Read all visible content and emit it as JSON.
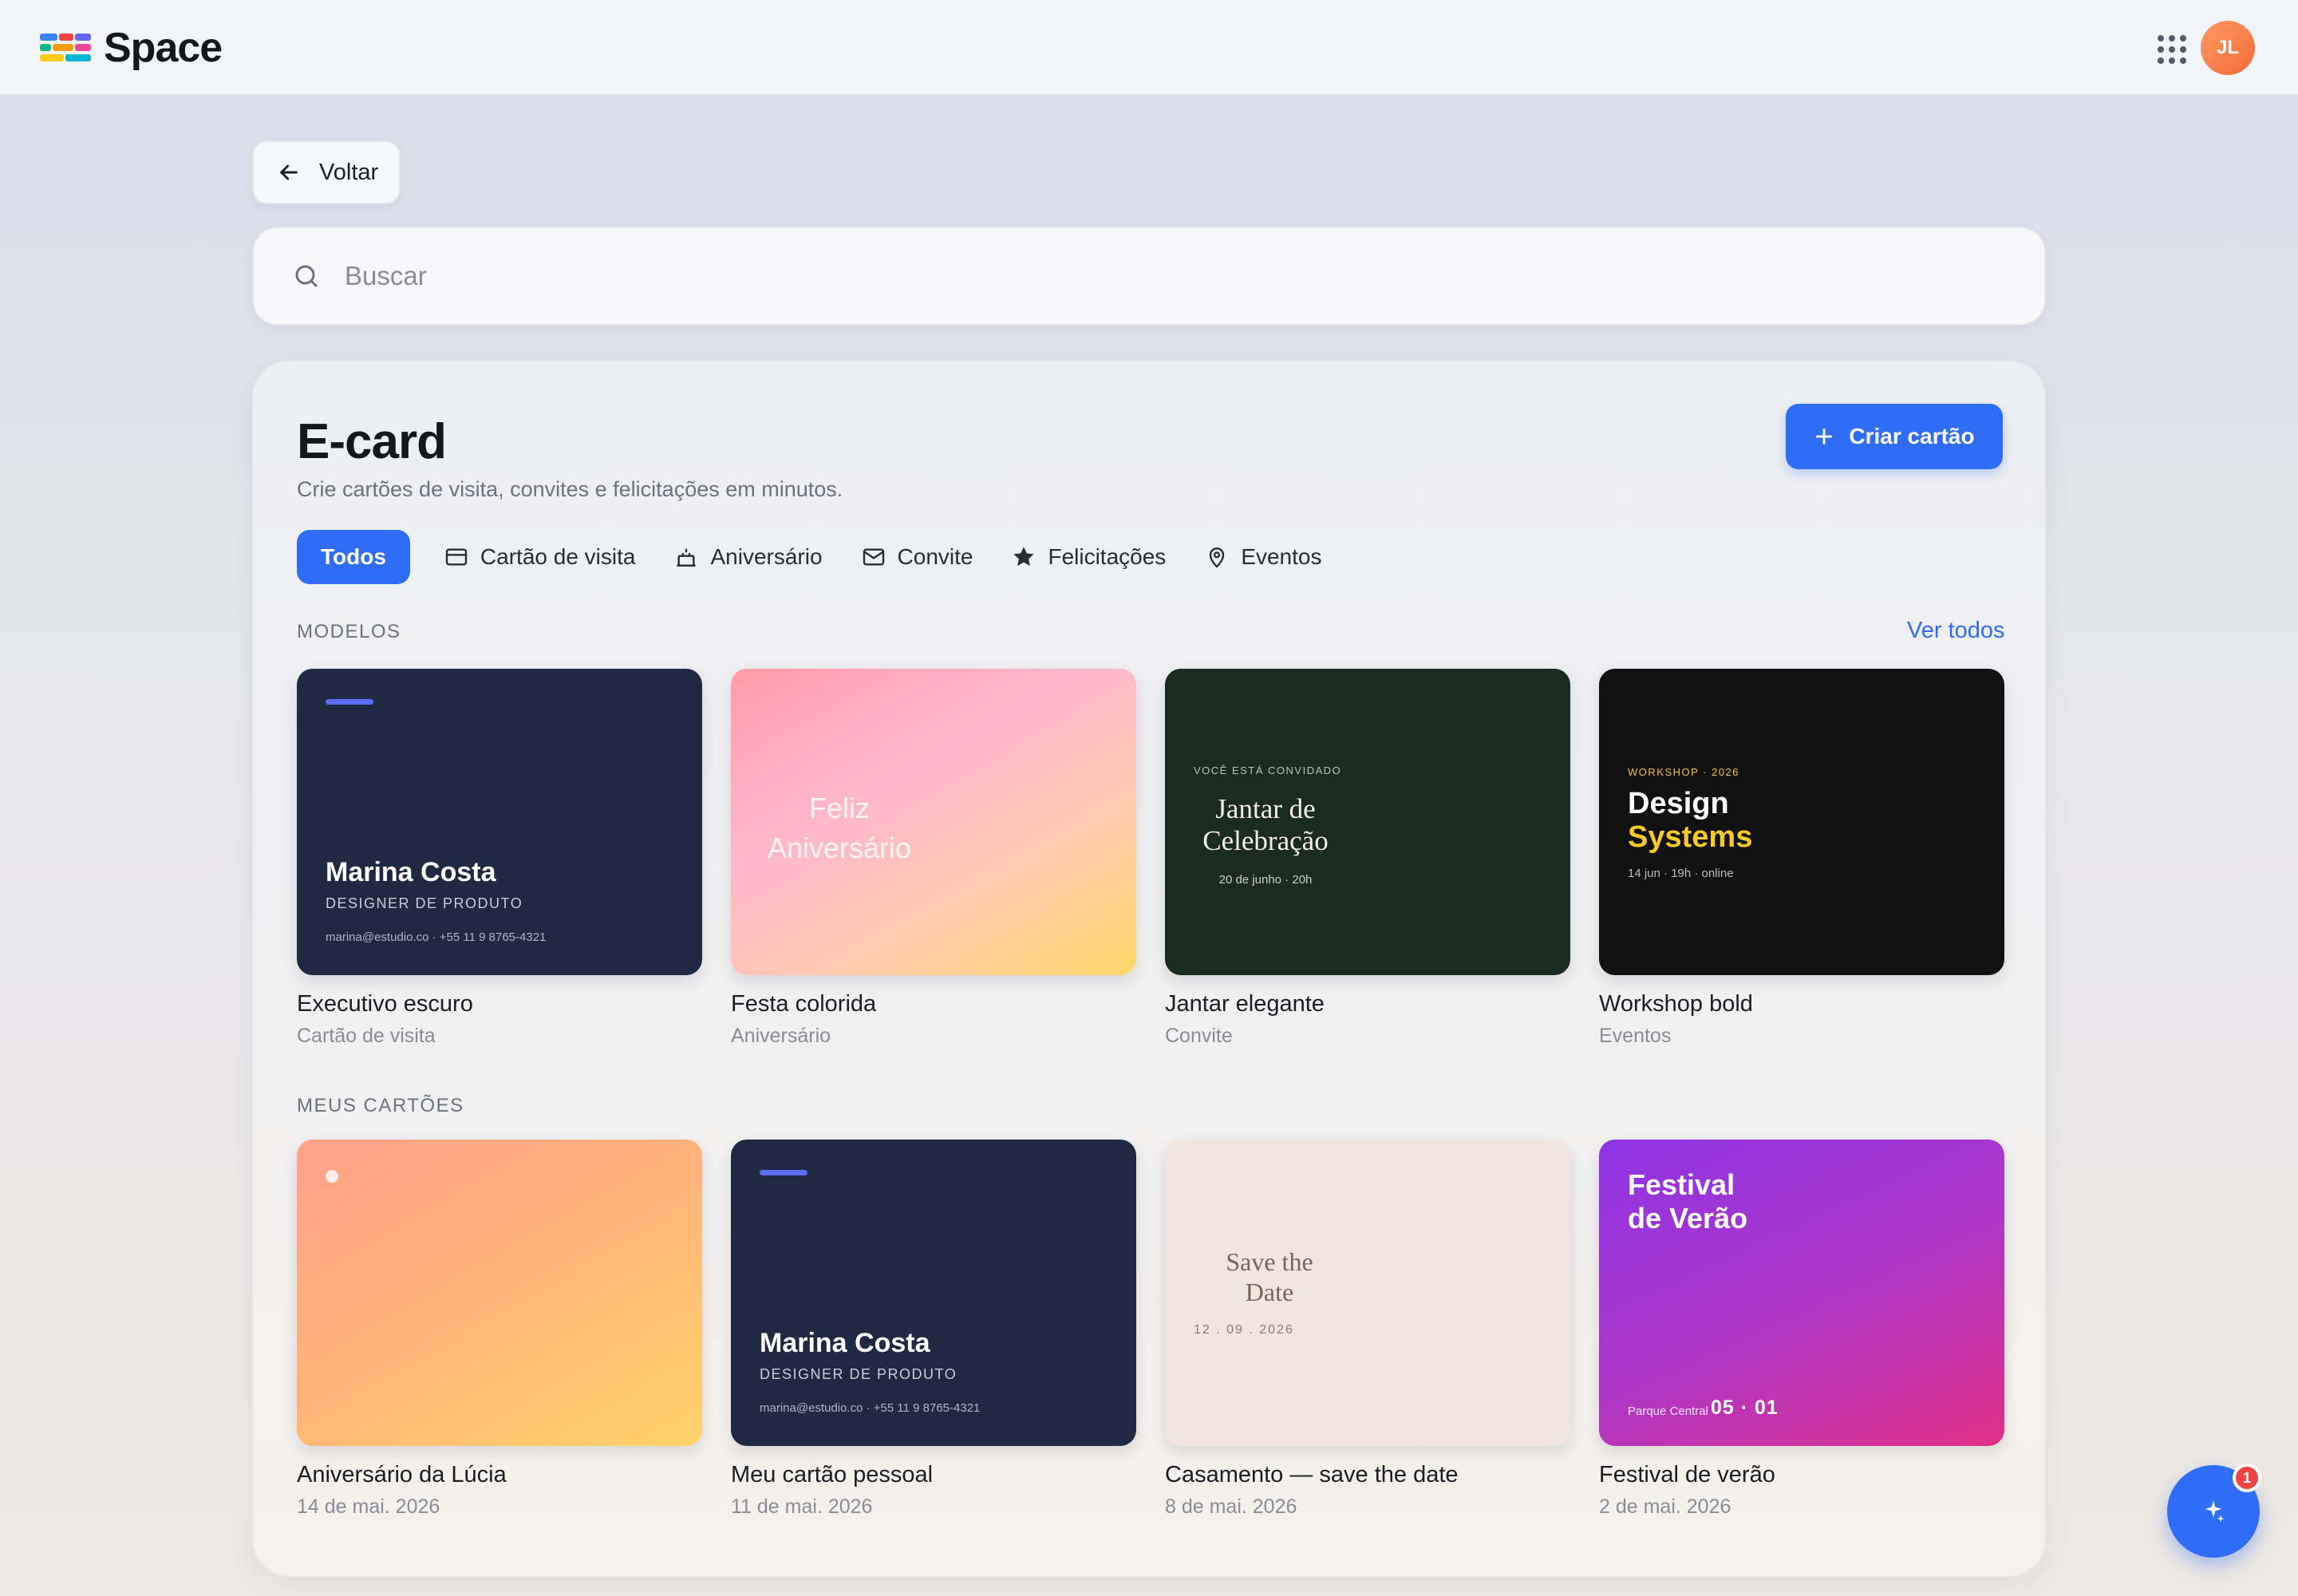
{
  "app": {
    "name": "Space",
    "avatar_initials": "JL"
  },
  "nav": {
    "back_label": "Voltar"
  },
  "search": {
    "placeholder": "Buscar",
    "value": ""
  },
  "page": {
    "title": "E-card",
    "subtitle": "Crie cartões de visita, convites e felicitações em minutos.",
    "create_label": "Criar cartão"
  },
  "filters": [
    {
      "label": "Todos",
      "icon": "none",
      "active": true
    },
    {
      "label": "Cartão de visita",
      "icon": "card-icon"
    },
    {
      "label": "Aniversário",
      "icon": "cake-icon"
    },
    {
      "label": "Convite",
      "icon": "mail-icon"
    },
    {
      "label": "Felicitações",
      "icon": "star-icon"
    },
    {
      "label": "Eventos",
      "icon": "map-pin-icon"
    }
  ],
  "templates": {
    "section_label": "MODELOS",
    "see_all": "Ver todos",
    "items": [
      {
        "name": "Executivo escuro",
        "category": "Cartão de visita",
        "thumb": {
          "person": "Marina Costa",
          "role": "DESIGNER DE PRODUTO",
          "contact": "marina@estudio.co · +55 11 9 8765-4321"
        }
      },
      {
        "name": "Festa colorida",
        "category": "Aniversário",
        "thumb": {
          "line1": "Feliz",
          "line2": "Aniversário"
        }
      },
      {
        "name": "Jantar elegante",
        "category": "Convite",
        "thumb": {
          "kicker": "VOCÊ ESTÁ CONVIDADO",
          "line1": "Jantar de",
          "line2": "Celebração",
          "detail": "20 de junho · 20h"
        }
      },
      {
        "name": "Workshop bold",
        "category": "Eventos",
        "thumb": {
          "kicker": "WORKSHOP · 2026",
          "line1": "Design",
          "line2": "Systems",
          "detail": "14 jun · 19h · online"
        }
      }
    ]
  },
  "my_cards": {
    "section_label": "MEUS CARTÕES",
    "items": [
      {
        "name": "Aniversário da Lúcia",
        "date": "14 de mai. 2026"
      },
      {
        "name": "Meu cartão pessoal",
        "date": "11 de mai. 2026",
        "thumb": {
          "person": "Marina Costa",
          "role": "DESIGNER DE PRODUTO",
          "contact": "marina@estudio.co · +55 11 9 8765-4321"
        }
      },
      {
        "name": "Casamento — save the date",
        "date": "8 de mai. 2026",
        "thumb": {
          "line1": "Save the",
          "line2": "Date",
          "detail": "12 . 09 . 2026"
        }
      },
      {
        "name": "Festival de verão",
        "date": "2 de mai. 2026",
        "thumb": {
          "line1": "Festival",
          "line2": "de Verão",
          "location": "Parque Central",
          "date_big": "05 · 01"
        }
      }
    ]
  },
  "fab": {
    "badge": "1",
    "icon": "sparkle-icon"
  },
  "colors": {
    "accent": "#2f6df6",
    "navy": "#1f2942",
    "forest": "#1a2c22",
    "gold": "#f9c927",
    "badge": "#ef4444"
  }
}
